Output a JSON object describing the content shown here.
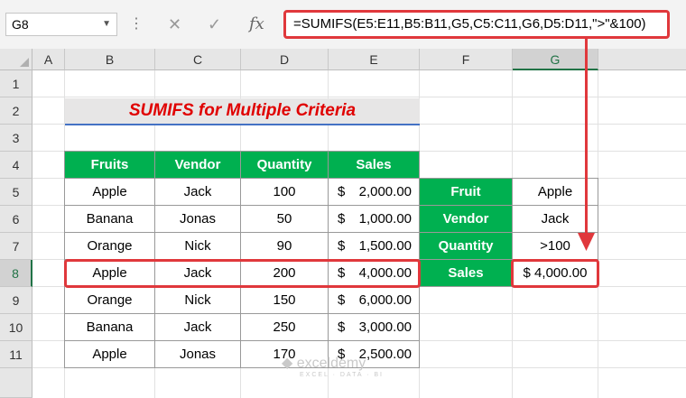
{
  "formula_bar": {
    "name_box": "G8",
    "cancel_symbol": "✕",
    "enter_symbol": "✓",
    "fx_symbol": "fx",
    "formula": "=SUMIFS(E5:E11,B5:B11,G5,C5:C11,G6,D5:D11,\">\"&100)"
  },
  "columns": [
    "A",
    "B",
    "C",
    "D",
    "E",
    "F",
    "G"
  ],
  "rows": [
    "1",
    "2",
    "3",
    "4",
    "5",
    "6",
    "7",
    "8",
    "9",
    "10",
    "11"
  ],
  "selected_cell": "G8",
  "title": "SUMIFS for Multiple Criteria",
  "table": {
    "headers": [
      "Fruits",
      "Vendor",
      "Quantity",
      "Sales"
    ],
    "rows": [
      {
        "fruit": "Apple",
        "vendor": "Jack",
        "qty": "100",
        "cur": "$",
        "amount": "2,000.00"
      },
      {
        "fruit": "Banana",
        "vendor": "Jonas",
        "qty": "50",
        "cur": "$",
        "amount": "1,000.00"
      },
      {
        "fruit": "Orange",
        "vendor": "Nick",
        "qty": "90",
        "cur": "$",
        "amount": "1,500.00"
      },
      {
        "fruit": "Apple",
        "vendor": "Jack",
        "qty": "200",
        "cur": "$",
        "amount": "4,000.00"
      },
      {
        "fruit": "Orange",
        "vendor": "Nick",
        "qty": "150",
        "cur": "$",
        "amount": "6,000.00"
      },
      {
        "fruit": "Banana",
        "vendor": "Jack",
        "qty": "250",
        "cur": "$",
        "amount": "3,000.00"
      },
      {
        "fruit": "Apple",
        "vendor": "Jonas",
        "qty": "170",
        "cur": "$",
        "amount": "2,500.00"
      }
    ]
  },
  "criteria": {
    "labels": [
      "Fruit",
      "Vendor",
      "Quantity",
      "Sales"
    ],
    "values": [
      "Apple",
      "Jack",
      ">100",
      "$ 4,000.00"
    ]
  },
  "watermark": {
    "name": "exceldemy",
    "tagline": "EXCEL · DATA · BI"
  },
  "colors": {
    "header_green": "#00b050",
    "highlight_red": "#e0383c",
    "title_red": "#e00000",
    "title_underline": "#4472c4"
  }
}
